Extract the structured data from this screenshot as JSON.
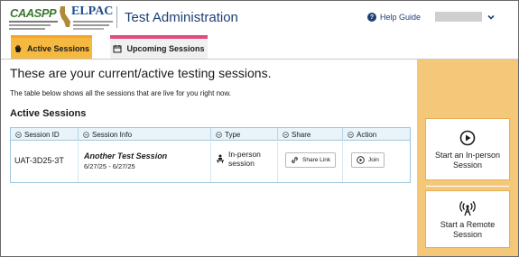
{
  "header": {
    "logo_caaspp": "CAASPP",
    "logo_elpac": "ELPAC",
    "app_title": "Test Administration",
    "help_label": "Help Guide",
    "user_name": "",
    "icons": {
      "help": "question-circle-icon",
      "user_menu": "chevron-down-icon"
    }
  },
  "tabs": [
    {
      "label": "Active Sessions",
      "icon": "hand-icon",
      "active": true
    },
    {
      "label": "Upcoming Sessions",
      "icon": "calendar-icon",
      "active": false
    }
  ],
  "main": {
    "heading": "These are your current/active testing sessions.",
    "description": "The table below shows all the sessions that are live for you right now.",
    "section_heading": "Active Sessions",
    "table": {
      "columns": [
        "Session ID",
        "Session Info",
        "Type",
        "Share",
        "Action"
      ],
      "rows": [
        {
          "session_id": "UAT-3D25-3T",
          "session_name": "Another Test Session",
          "session_dates": "6/27/25 - 6/27/25",
          "type": "In-person session",
          "share_label": "Share Link",
          "action_label": "Join"
        }
      ]
    }
  },
  "side_panel": {
    "start_inperson": "Start an In-person Session",
    "start_remote": "Start a Remote Session",
    "icons": {
      "inperson": "play-circle-icon",
      "remote": "broadcast-tower-icon"
    }
  },
  "colors": {
    "active_tab": "#f5b942",
    "upcoming_tab_accent": "#e2497d",
    "side_panel": "#f5c879",
    "title": "#1c3f73",
    "table_border": "#9ec6df"
  }
}
